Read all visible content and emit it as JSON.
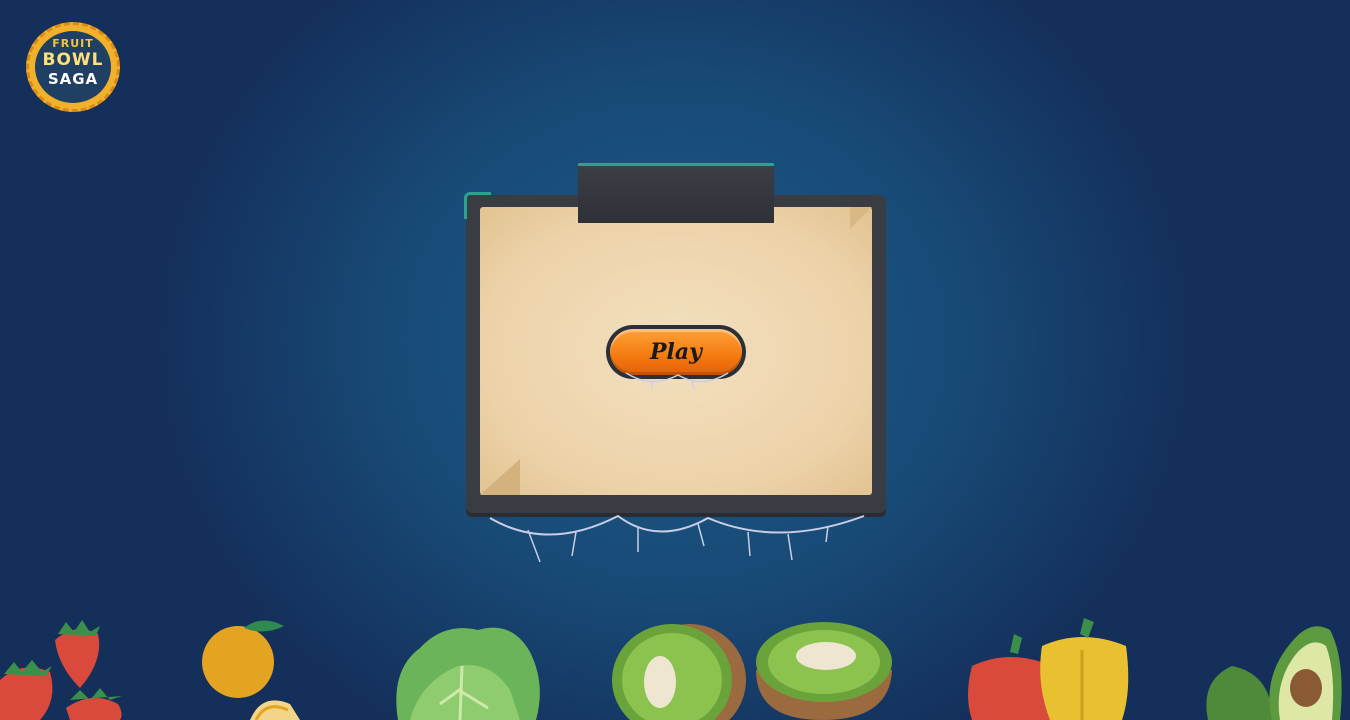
{
  "logo": {
    "line1": "FRUIT",
    "line2": "BOWL",
    "line3": "SAGA"
  },
  "menu": {
    "play_label": "Play"
  },
  "colors": {
    "background": "#184a76",
    "board": "#3a3c44",
    "paper": "#ecd2a8",
    "button": "#f47d12",
    "accent_teal": "#2aa38f"
  },
  "decorations": [
    "strawberry-icon",
    "orange-icon",
    "lettuce-icon",
    "kiwi-icon",
    "kiwi-icon",
    "red-pepper-icon",
    "yellow-pepper-icon",
    "avocado-icon"
  ]
}
